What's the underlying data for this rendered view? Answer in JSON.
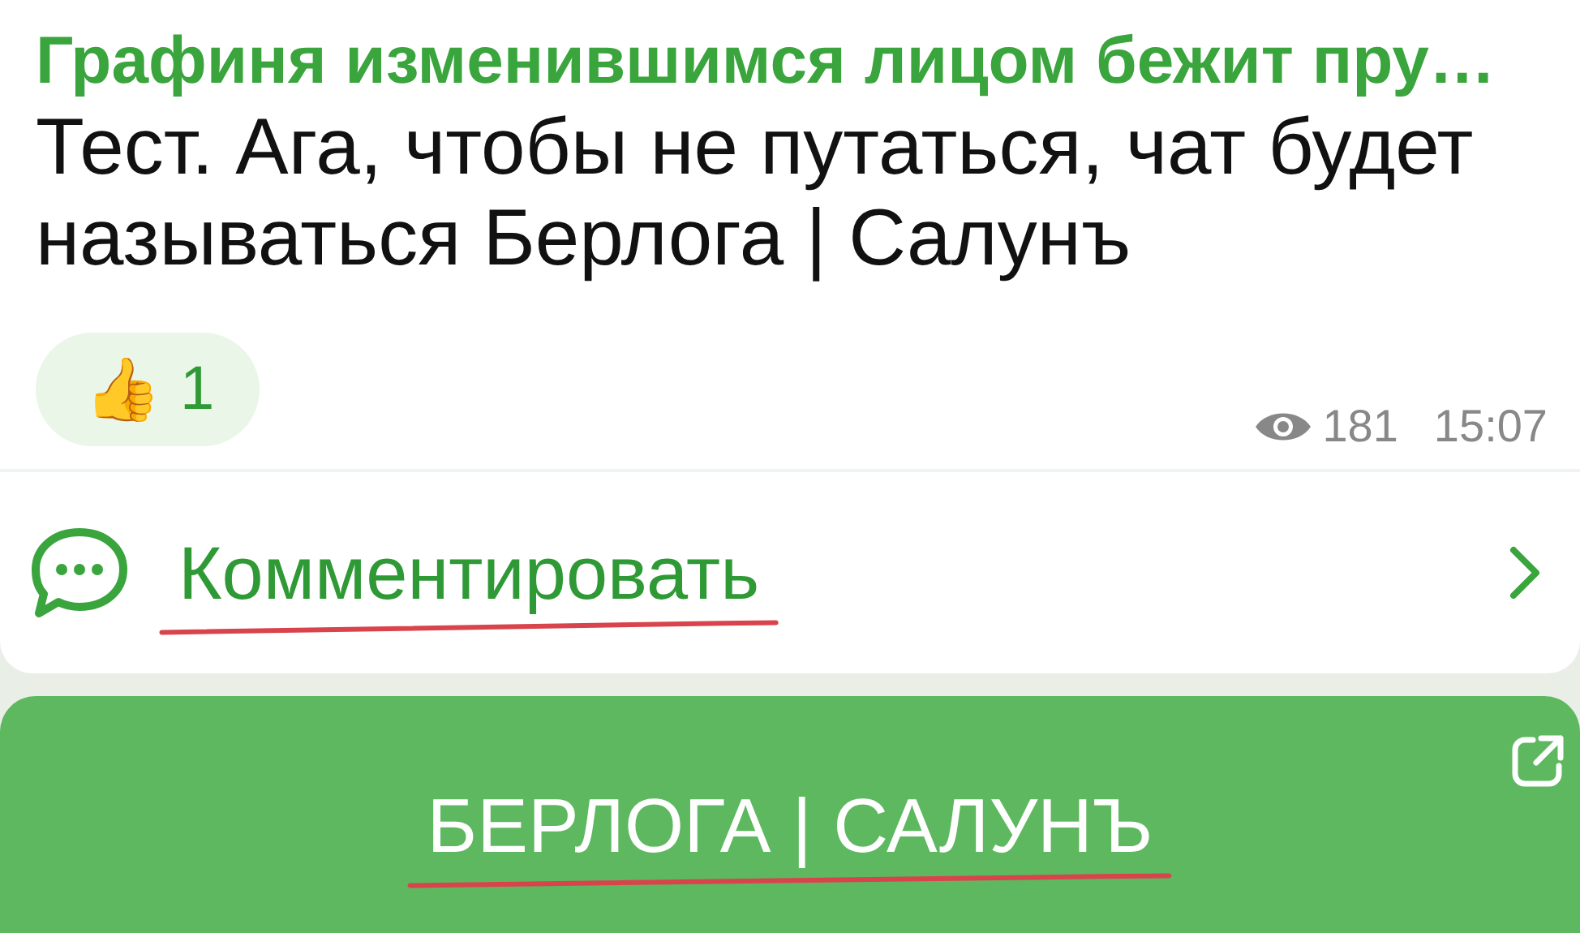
{
  "post": {
    "sender": "Графиня изменившимся лицом бежит пру…",
    "text": "Тест. Ага, чтобы не путаться, чат будет называться Берлога | Салунъ",
    "reactions": [
      {
        "emoji": "👍",
        "count": "1",
        "selected": false
      }
    ],
    "views": "181",
    "time": "15:07"
  },
  "comments": {
    "label": "Комментировать",
    "underlined": true
  },
  "chat_button": {
    "label": "БЕРЛОГА | САЛУНЪ",
    "underlined": true
  }
}
